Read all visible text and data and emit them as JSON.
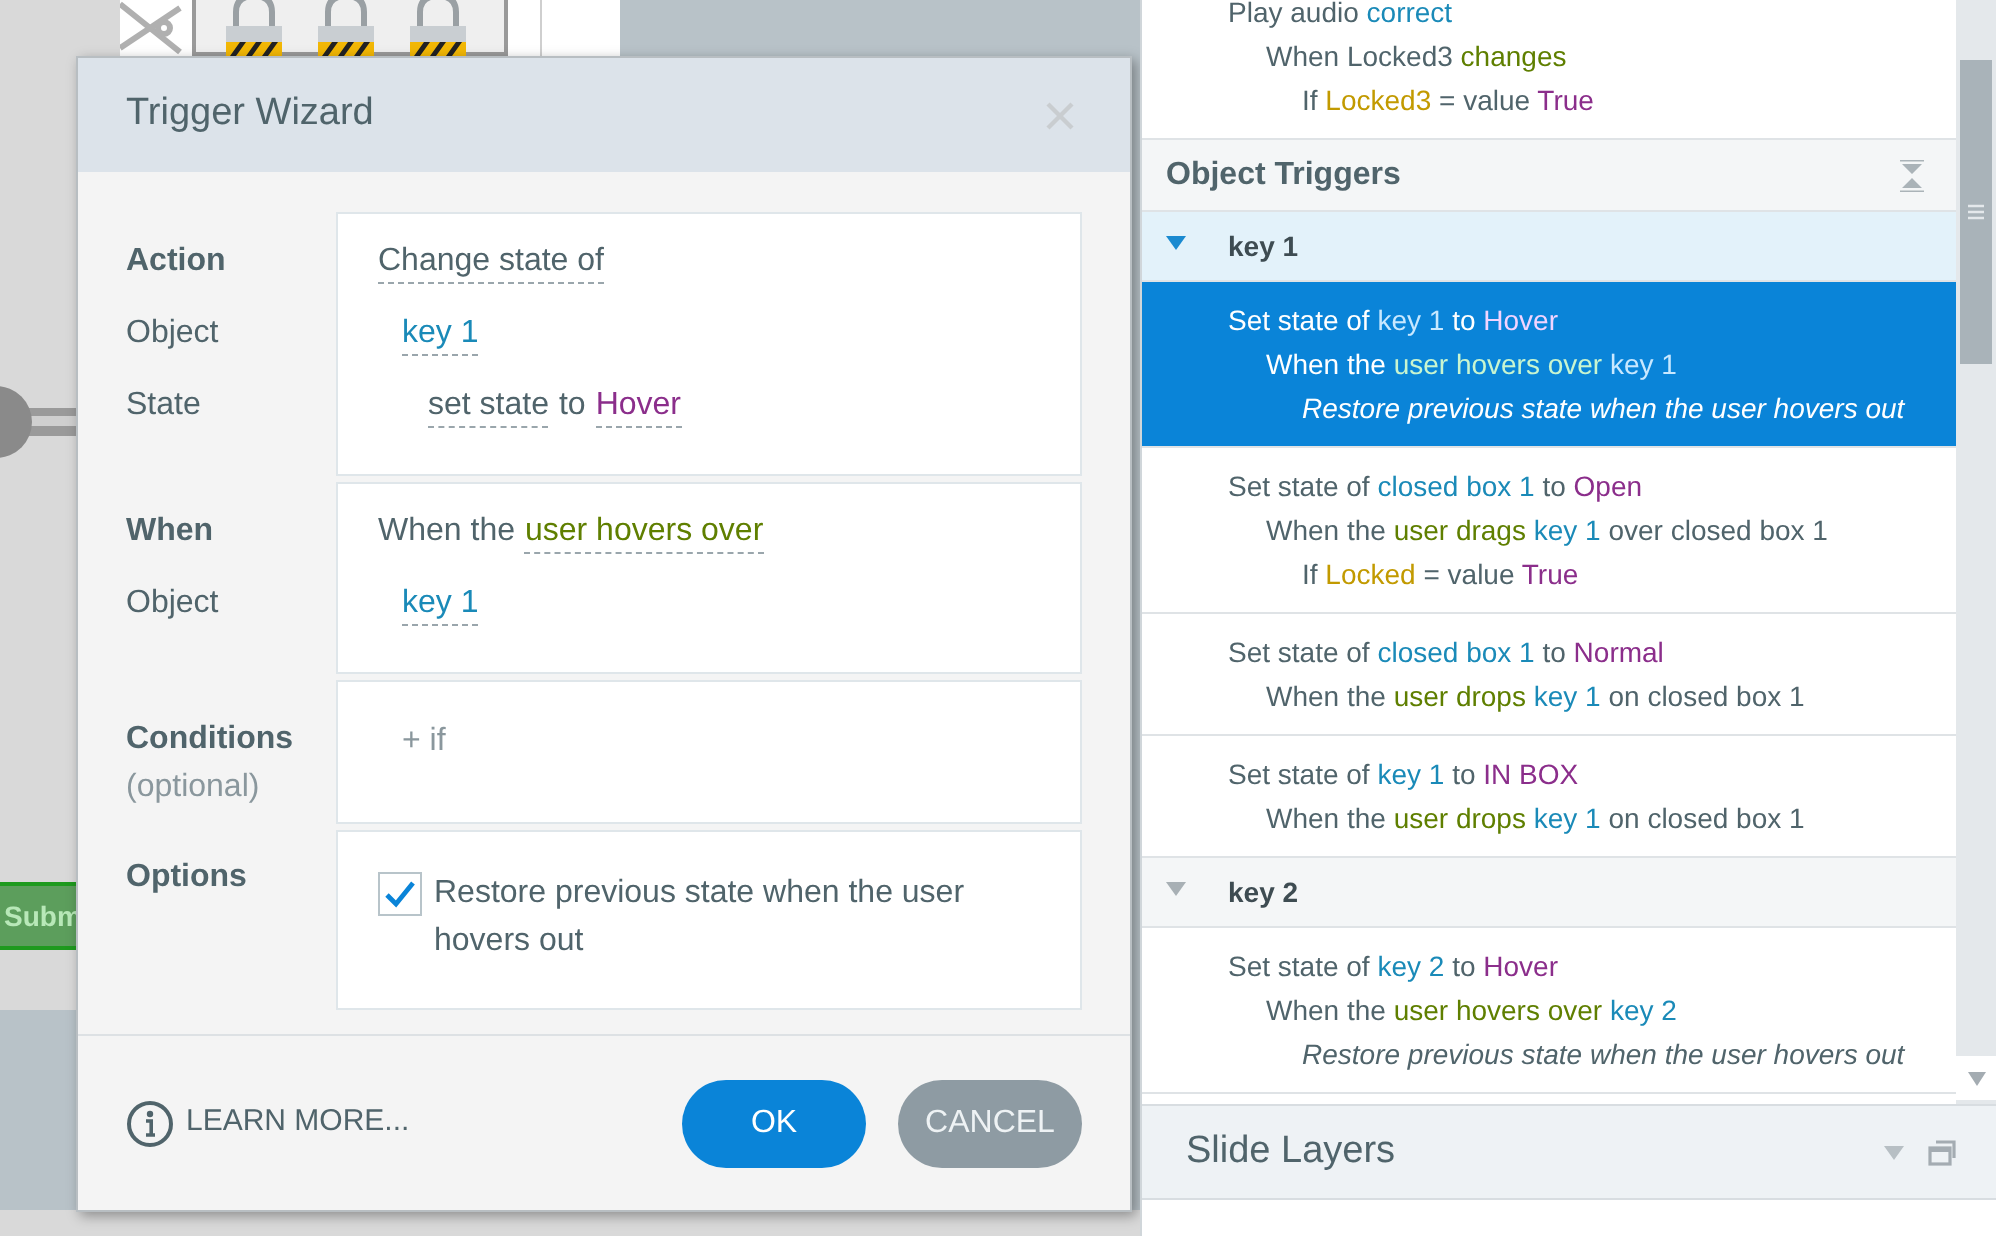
{
  "canvas": {
    "button_label": "Subm"
  },
  "dialog": {
    "title": "Trigger Wizard",
    "sections": [
      {
        "kind": "fields",
        "rows": [
          {
            "label": "Action",
            "kind": "action",
            "segments": [
              {
                "text": "Change state of",
                "kind": "plain",
                "link": true
              }
            ]
          },
          {
            "label": "Object",
            "kind": "object",
            "segments": [
              {
                "text": "key 1",
                "kind": "object",
                "link": true
              }
            ]
          },
          {
            "label": "State",
            "kind": "state",
            "segments": [
              {
                "text": "set state",
                "kind": "plain",
                "link": true
              },
              {
                "text": "to",
                "kind": "plain",
                "link": false
              },
              {
                "text": "Hover",
                "kind": "state",
                "link": true
              }
            ]
          }
        ]
      },
      {
        "kind": "fields",
        "rows": [
          {
            "label": "When",
            "kind": "action",
            "segments": [
              {
                "text": "When the",
                "kind": "plain",
                "link": false
              },
              {
                "text": "user hovers over",
                "kind": "event",
                "link": true
              }
            ]
          },
          {
            "label": "Object",
            "kind": "object",
            "segments": [
              {
                "text": "key 1",
                "kind": "object",
                "link": true
              }
            ]
          }
        ]
      },
      {
        "kind": "conditions",
        "label": "Conditions",
        "hint": "(optional)",
        "add_label": "+ if"
      },
      {
        "kind": "options",
        "label": "Options",
        "options": [
          {
            "label": "Restore previous state when the user hovers out",
            "checked": true
          }
        ]
      }
    ],
    "help_link": "LEARN MORE...",
    "buttons": [
      {
        "label": "OK",
        "kind": "primary"
      },
      {
        "label": "CANCEL",
        "kind": "secondary"
      }
    ]
  },
  "trigger_panel": {
    "top_trigger_lines": [
      {
        "kind": "action",
        "segments": [
          {
            "text": "Play audio ",
            "kind": "plain"
          },
          {
            "text": "correct",
            "kind": "object"
          }
        ]
      },
      {
        "kind": "when",
        "segments": [
          {
            "text": "When Locked3 ",
            "kind": "plain"
          },
          {
            "text": "changes",
            "kind": "event"
          }
        ]
      },
      {
        "kind": "condition",
        "segments": [
          {
            "text": "If ",
            "kind": "plain"
          },
          {
            "text": "Locked3",
            "kind": "variable"
          },
          {
            "text": " = value ",
            "kind": "plain"
          },
          {
            "text": "True",
            "kind": "value"
          }
        ]
      }
    ],
    "object_triggers": {
      "title": "Object Triggers",
      "groups": [
        {
          "name": "key 1",
          "expanded": true,
          "triggers": [
            {
              "selected": true,
              "lines": [
                {
                  "kind": "action",
                  "segments": [
                    {
                      "text": "Set state of ",
                      "kind": "plain"
                    },
                    {
                      "text": "key 1",
                      "kind": "object"
                    },
                    {
                      "text": " to ",
                      "kind": "plain"
                    },
                    {
                      "text": "Hover",
                      "kind": "state"
                    }
                  ]
                },
                {
                  "kind": "when",
                  "segments": [
                    {
                      "text": "When the ",
                      "kind": "plain"
                    },
                    {
                      "text": "user hovers over",
                      "kind": "event"
                    },
                    {
                      "text": " key 1",
                      "kind": "object"
                    }
                  ]
                },
                {
                  "kind": "option",
                  "segments": [
                    {
                      "text": "Restore previous state when the user hovers out",
                      "kind": "plain"
                    }
                  ]
                }
              ]
            },
            {
              "selected": false,
              "lines": [
                {
                  "kind": "action",
                  "segments": [
                    {
                      "text": "Set state of ",
                      "kind": "plain"
                    },
                    {
                      "text": "closed box 1",
                      "kind": "object"
                    },
                    {
                      "text": " to ",
                      "kind": "plain"
                    },
                    {
                      "text": "Open",
                      "kind": "state"
                    }
                  ]
                },
                {
                  "kind": "when",
                  "segments": [
                    {
                      "text": "When the ",
                      "kind": "plain"
                    },
                    {
                      "text": "user drags",
                      "kind": "event"
                    },
                    {
                      "text": " key 1",
                      "kind": "object"
                    },
                    {
                      "text": " over closed box 1",
                      "kind": "plain"
                    }
                  ]
                },
                {
                  "kind": "condition",
                  "segments": [
                    {
                      "text": "If ",
                      "kind": "plain"
                    },
                    {
                      "text": "Locked",
                      "kind": "variable"
                    },
                    {
                      "text": " = value ",
                      "kind": "plain"
                    },
                    {
                      "text": "True",
                      "kind": "value"
                    }
                  ]
                }
              ]
            },
            {
              "selected": false,
              "lines": [
                {
                  "kind": "action",
                  "segments": [
                    {
                      "text": "Set state of ",
                      "kind": "plain"
                    },
                    {
                      "text": "closed box 1",
                      "kind": "object"
                    },
                    {
                      "text": " to ",
                      "kind": "plain"
                    },
                    {
                      "text": "Normal",
                      "kind": "state"
                    }
                  ]
                },
                {
                  "kind": "when",
                  "segments": [
                    {
                      "text": "When the ",
                      "kind": "plain"
                    },
                    {
                      "text": "user drops",
                      "kind": "event"
                    },
                    {
                      "text": " key 1",
                      "kind": "object"
                    },
                    {
                      "text": " on closed box 1",
                      "kind": "plain"
                    }
                  ]
                }
              ]
            },
            {
              "selected": false,
              "lines": [
                {
                  "kind": "action",
                  "segments": [
                    {
                      "text": "Set state of ",
                      "kind": "plain"
                    },
                    {
                      "text": "key 1",
                      "kind": "object"
                    },
                    {
                      "text": " to ",
                      "kind": "plain"
                    },
                    {
                      "text": "IN BOX",
                      "kind": "state"
                    }
                  ]
                },
                {
                  "kind": "when",
                  "segments": [
                    {
                      "text": "When the ",
                      "kind": "plain"
                    },
                    {
                      "text": "user drops",
                      "kind": "event"
                    },
                    {
                      "text": " key 1",
                      "kind": "object"
                    },
                    {
                      "text": " on closed box 1",
                      "kind": "plain"
                    }
                  ]
                }
              ]
            }
          ]
        },
        {
          "name": "key 2",
          "expanded": true,
          "triggers": [
            {
              "selected": false,
              "lines": [
                {
                  "kind": "action",
                  "segments": [
                    {
                      "text": "Set state of ",
                      "kind": "plain"
                    },
                    {
                      "text": "key 2",
                      "kind": "object"
                    },
                    {
                      "text": " to ",
                      "kind": "plain"
                    },
                    {
                      "text": "Hover",
                      "kind": "state"
                    }
                  ]
                },
                {
                  "kind": "when",
                  "segments": [
                    {
                      "text": "When the ",
                      "kind": "plain"
                    },
                    {
                      "text": "user hovers over",
                      "kind": "event"
                    },
                    {
                      "text": " key 2",
                      "kind": "object"
                    }
                  ]
                },
                {
                  "kind": "option",
                  "segments": [
                    {
                      "text": "Restore previous state when the user hovers out",
                      "kind": "plain"
                    }
                  ]
                }
              ]
            }
          ]
        }
      ]
    }
  },
  "slide_layers": {
    "title": "Slide Layers"
  }
}
